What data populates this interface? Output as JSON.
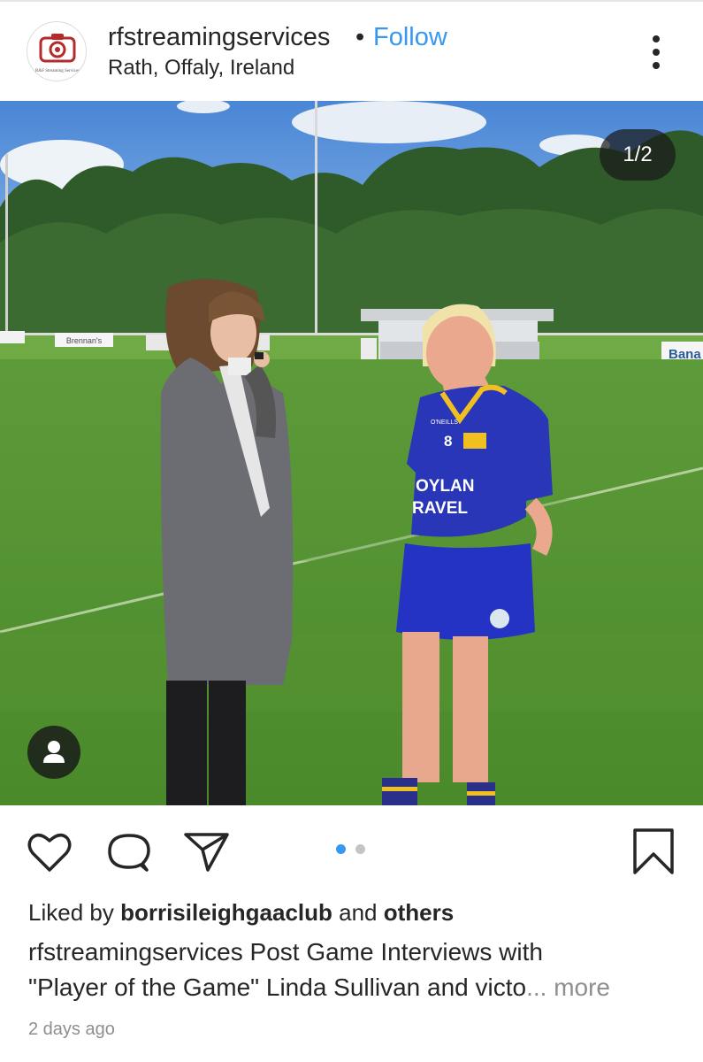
{
  "header": {
    "username": "rfstreamingservices",
    "separator": "•",
    "follow_label": "Follow",
    "location": "Rath, Offaly, Ireland",
    "avatar_text": "R&F Streaming Services"
  },
  "photo": {
    "counter": "1/2",
    "signage": {
      "left_board": "Brennan's",
      "right_board": "Bana"
    },
    "jersey": {
      "number": "8",
      "brand": "O'NEILLS",
      "sponsor_line1": "OYLAN",
      "sponsor_line2": "RAVEL"
    }
  },
  "actions": {
    "icons": [
      "heart-icon",
      "comment-icon",
      "share-icon",
      "bookmark-icon"
    ],
    "carousel_active_color": "#3897f0",
    "carousel_inactive_color": "#c4c4c4"
  },
  "post": {
    "liked_by_prefix": "Liked by ",
    "liked_by_user": "borrisileighgaaclub",
    "liked_by_suffix": " and ",
    "liked_by_others": "others",
    "caption_user": "rfstreamingservices",
    "caption_line1": " Post Game Interviews with",
    "caption_line2": "\"Player of the Game\" Linda Sullivan and victo",
    "ellipsis": "...",
    "more_label": " more",
    "timestamp": "2 days ago"
  }
}
